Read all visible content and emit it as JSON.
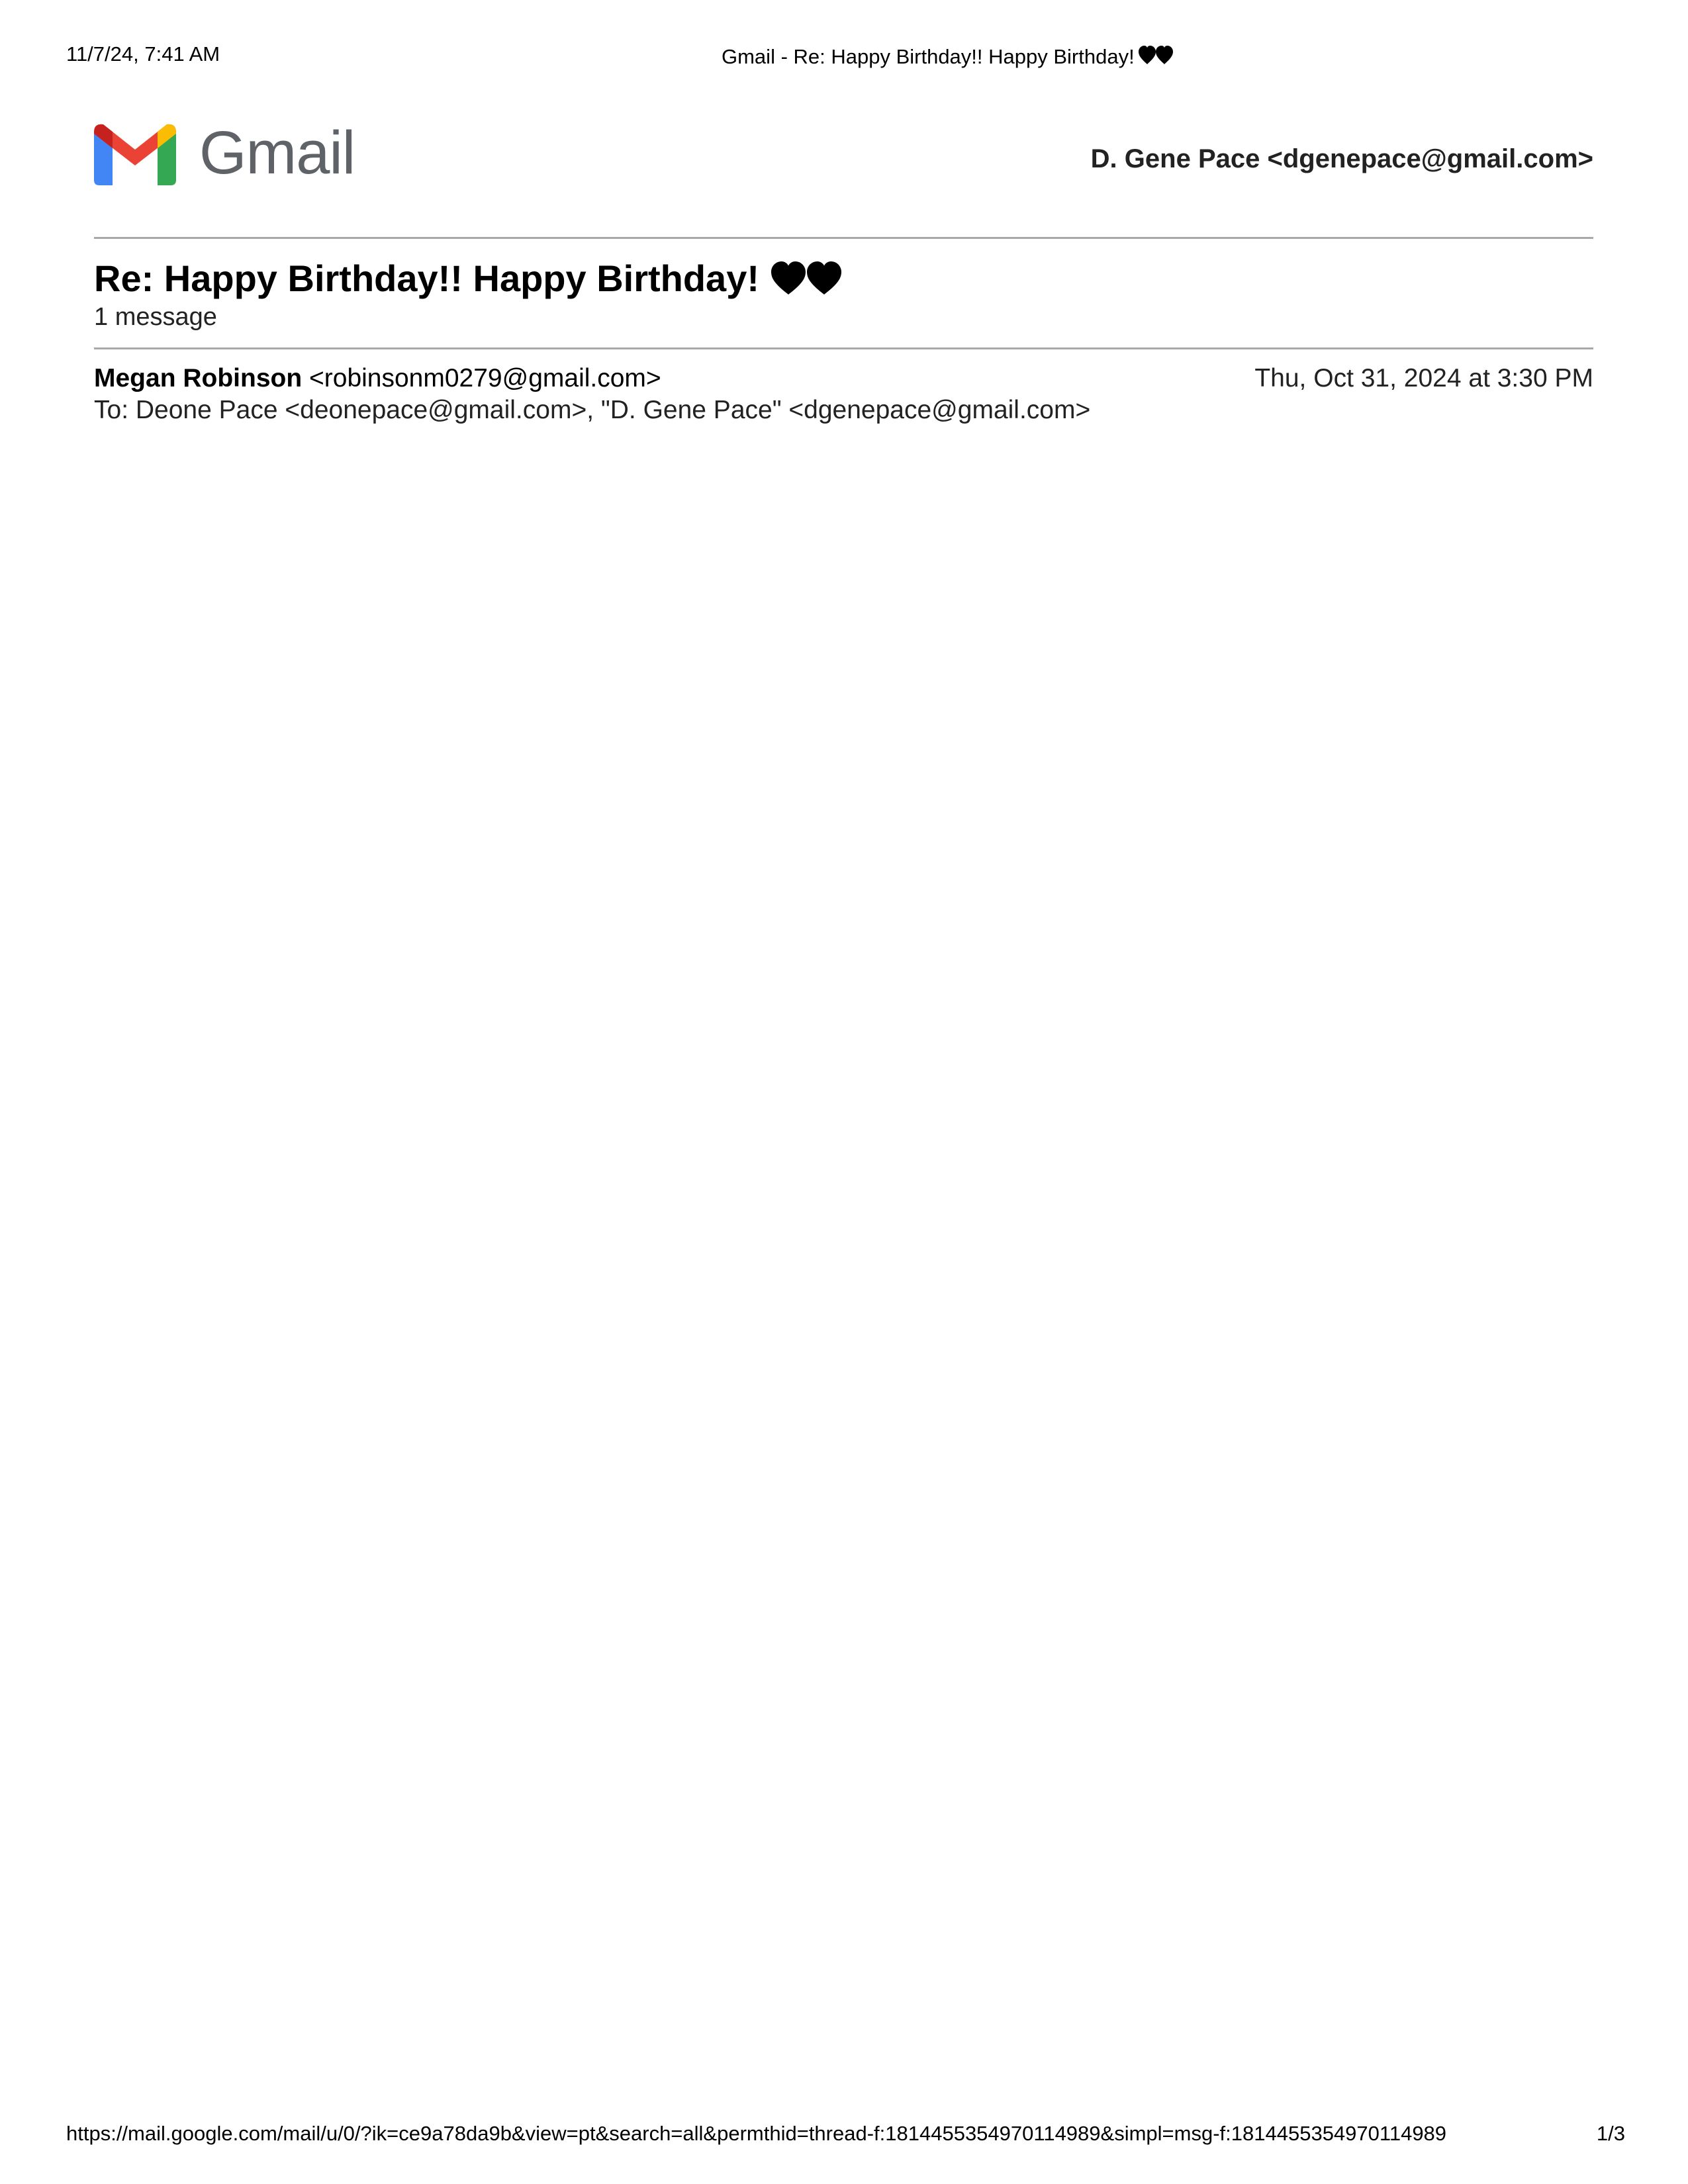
{
  "print_header": {
    "datetime": "11/7/24, 7:41 AM",
    "title": "Gmail - Re: Happy Birthday!! Happy Birthday!"
  },
  "logo": {
    "icon": "gmail-m-icon",
    "wordmark": "Gmail"
  },
  "account": {
    "label": "D. Gene Pace <dgenepace@gmail.com>"
  },
  "thread": {
    "subject": "Re: Happy Birthday!! Happy Birthday!",
    "subject_emoji": "black-heart-icon",
    "message_count": "1 message"
  },
  "message": {
    "from_name": "Megan Robinson",
    "from_email": "<robinsonm0279@gmail.com>",
    "date": "Thu, Oct 31, 2024 at 3:30 PM",
    "to": "To: Deone Pace <deonepace@gmail.com>, \"D. Gene Pace\" <dgenepace@gmail.com>"
  },
  "print_footer": {
    "url": "https://mail.google.com/mail/u/0/?ik=ce9a78da9b&view=pt&search=all&permthid=thread-f:1814455354970114989&simpl=msg-f:1814455354970114989",
    "page": "1/3"
  },
  "colors": {
    "gmail_red": "#EA4335",
    "gmail_blue": "#4285F4",
    "gmail_green": "#34A853",
    "gmail_yellow": "#FBBC04",
    "gmail_dark_red": "#C5221F",
    "wordmark_gray": "#5f6368",
    "rule_gray": "#a8a8a8"
  }
}
